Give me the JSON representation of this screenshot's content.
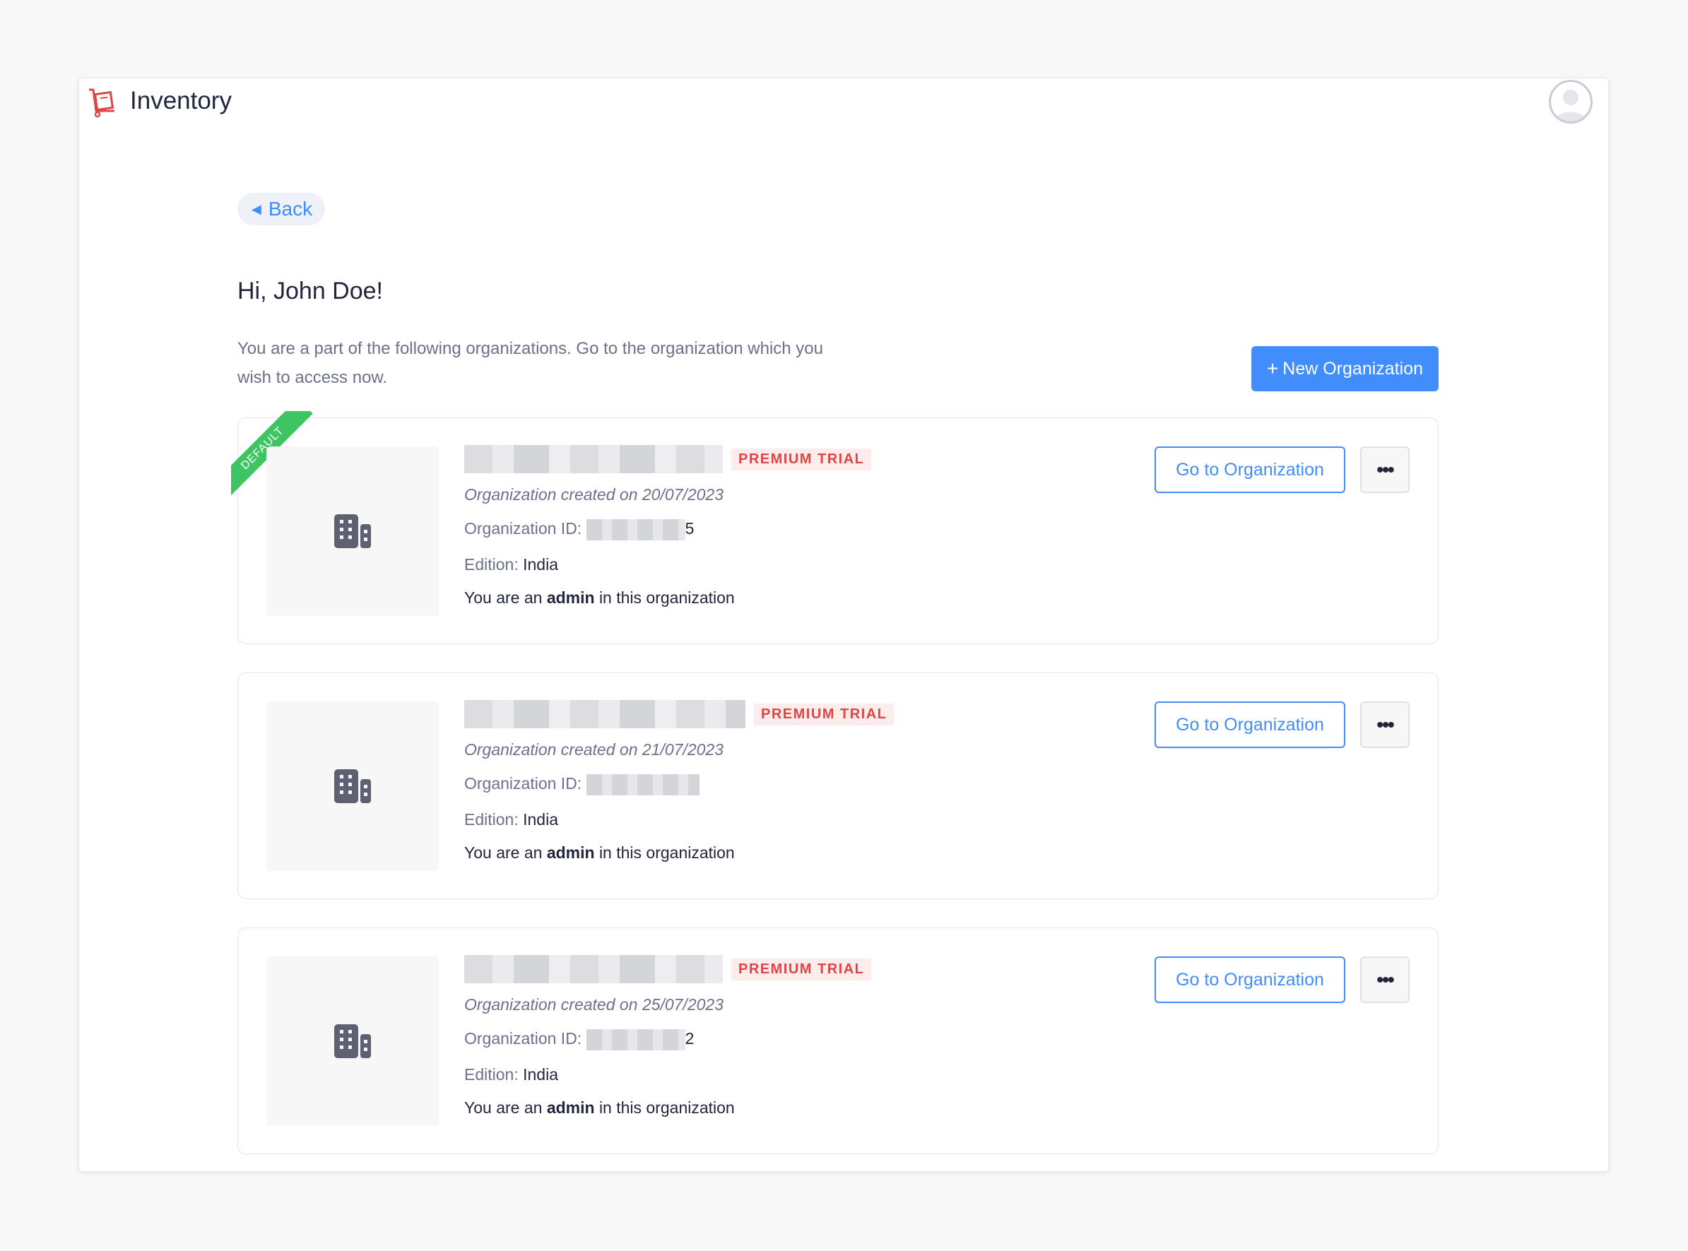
{
  "app": {
    "title": "Inventory",
    "brand_color": "#e04545"
  },
  "back": {
    "label": "Back"
  },
  "greeting": "Hi, John Doe!",
  "subtitle": "You are a part of the following organizations. Go to the organization which you wish to access now.",
  "new_org_button": {
    "icon": "+",
    "label": "New Organization"
  },
  "organizations": [
    {
      "default_label": "DEFAULT",
      "badge": "PREMIUM TRIAL",
      "created": "Organization created on 20/07/2023",
      "id_label": "Organization ID:",
      "id_tail": "5",
      "edition_label": "Edition:",
      "edition": "India",
      "role_prefix": "You are an",
      "role": "admin",
      "role_suffix": "in this organization",
      "go_label": "Go to Organization",
      "more_label": "•••"
    },
    {
      "badge": "PREMIUM TRIAL",
      "created": "Organization created on 21/07/2023",
      "id_label": "Organization ID:",
      "id_tail": "",
      "edition_label": "Edition:",
      "edition": "India",
      "role_prefix": "You are an",
      "role": "admin",
      "role_suffix": "in this organization",
      "go_label": "Go to Organization",
      "more_label": "•••"
    },
    {
      "badge": "PREMIUM TRIAL",
      "created": "Organization created on 25/07/2023",
      "id_label": "Organization ID:",
      "id_tail": "2",
      "edition_label": "Edition:",
      "edition": "India",
      "role_prefix": "You are an",
      "role": "admin",
      "role_suffix": "in this organization",
      "go_label": "Go to Organization",
      "more_label": "•••"
    }
  ],
  "colors": {
    "accent": "#408dfb",
    "premium": "#e04545",
    "default_ribbon": "#3ec463"
  },
  "icons": {
    "brand": "inventory-trolley-icon",
    "org": "building-icon",
    "back": "caret-left-icon",
    "avatar": "user-avatar-icon"
  }
}
